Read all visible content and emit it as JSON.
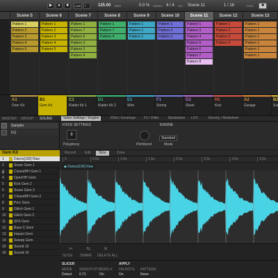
{
  "transport": {
    "tempo": "125.00",
    "tempo_unit": "BPM",
    "swing": "0.0 %",
    "swing_label": "SWING",
    "bpm_label": "BPM",
    "signature": "4 / 4",
    "sig_label": "SIG",
    "scene": "Scene 11",
    "grid": "1 / 16",
    "sync_label": "SYNC",
    "link_label": "LINK"
  },
  "scenes": [
    "Scene 5",
    "Scene 6",
    "Scene 7",
    "Scene 8",
    "Scene 9",
    "Scene 10",
    "Scene 11",
    "Scene 12",
    "Scene 13"
  ],
  "selected_scene": 6,
  "columns": [
    {
      "color": "#b89a2c",
      "cells": [
        "Pattern 1",
        "Pattern 2",
        "Pattern 3",
        "Pattern 4",
        "Pattern 5"
      ]
    },
    {
      "color": "#c8b400",
      "cells": [
        "Pattern 1",
        "Pattern 2",
        "Pattern 3",
        "Pattern 4",
        "Pattern 5"
      ]
    },
    {
      "color": "#8fb040",
      "cells": [
        "Pattern 1",
        "Pattern 7",
        "Pattern 5",
        "Pattern 3",
        "Pattern 2",
        "Pattern 4"
      ]
    },
    {
      "color": "#3faf6b",
      "cells": [
        "Pattern 1",
        "Pattern 7",
        "Pattern 4"
      ]
    },
    {
      "color": "#3fa7c6",
      "cells": [
        "Pattern 1",
        "Pattern 1",
        "Pattern 1"
      ]
    },
    {
      "color": "#6f6fd8",
      "cells": [
        "Pattern 1",
        "Pattern 2",
        "Pattern 3"
      ]
    },
    {
      "color": "#b15ec6",
      "cells": [
        "Pattern 1",
        "Pattern 3",
        "Pattern 4",
        "Pattern 5",
        "Pattern 6",
        "Pattern 7",
        "Pattern 8"
      ]
    },
    {
      "color": "#c84a3a",
      "cells": [
        "Pattern 1",
        "Pattern 2",
        "Pattern 3",
        "Pattern 4"
      ]
    },
    {
      "color": "#c8843a",
      "cells": [
        "Pattern 1",
        "Pattern 1",
        "Pattern 1",
        "Pattern 1",
        "Pattern 1",
        "Pattern 1"
      ]
    }
  ],
  "groups": [
    {
      "letter": "A1",
      "name": "Doer Kit",
      "color": "#c9a34a"
    },
    {
      "letter": "B1",
      "name": "Gem Kit",
      "color": "#c8b400"
    },
    {
      "letter": "C1",
      "name": "Klatter Kit 1",
      "color": "#9cc04a"
    },
    {
      "letter": "D1",
      "name": "Klatter Kit 2",
      "color": "#3fbf7a"
    },
    {
      "letter": "E1",
      "name": "Wim",
      "color": "#3fb2d6"
    },
    {
      "letter": "F1",
      "name": "Stomp",
      "color": "#8080e0"
    },
    {
      "letter": "G1",
      "name": "Skeel",
      "color": "#c070d8"
    },
    {
      "letter": "H1",
      "name": "Kick",
      "color": "#e05a4a"
    },
    {
      "letter": "A2",
      "name": "Garage",
      "color": "#e0903a"
    },
    {
      "letter": "B2",
      "name": "Sub",
      "color": "#e0c040"
    }
  ],
  "selected_group": 1,
  "tabs_left": [
    "MASTER",
    "GROUP",
    "SOUND"
  ],
  "tabs_params": [
    "Voice Settings / Engine",
    "Pitch / Envelope",
    "FX / Filter",
    "Modulation",
    "LFO",
    "Velocity / Modwheel"
  ],
  "voice": {
    "section1": "VOICE SETTINGS",
    "section2": "ENGINE",
    "polyphony_value": "8",
    "polyphony_label": "Polyphony",
    "pitchbend_label": "Pitchbend",
    "mode_value": "Standard",
    "mode_label": "Mode"
  },
  "sound_header": "Gem Kit",
  "plugin_slots": [
    {
      "name": "Sampler"
    },
    {
      "name": "EQ"
    }
  ],
  "sounds": [
    {
      "num": "1",
      "name": "Dairos[100] Raw",
      "color": "#c8b400"
    },
    {
      "num": "2",
      "name": "Snare Gem 1",
      "color": "#c8b400"
    },
    {
      "num": "3",
      "name": "ClosedHH Gem 1",
      "color": "#c8b400"
    },
    {
      "num": "4",
      "name": "OpenHH Gem",
      "color": "#c8b400"
    },
    {
      "num": "5",
      "name": "Kick Gem 2",
      "color": "#c8b400"
    },
    {
      "num": "6",
      "name": "Snare Gem 3",
      "color": "#c8b400"
    },
    {
      "num": "7",
      "name": "ClosedHH Gem 2",
      "color": "#c8b400"
    },
    {
      "num": "8",
      "name": "Perc Gem",
      "color": "#c8b400"
    },
    {
      "num": "9",
      "name": "Glitch Gem 1",
      "color": "#c8b400"
    },
    {
      "num": "10",
      "name": "Glitch Gem 2",
      "color": "#c8b400"
    },
    {
      "num": "11",
      "name": "SFX Gem",
      "color": "#c8b400"
    },
    {
      "num": "12",
      "name": "Bass C Gem",
      "color": "#c8b400"
    },
    {
      "num": "13",
      "name": "Impact Gem",
      "color": "#c8b400"
    },
    {
      "num": "14",
      "name": "Sweep Gem",
      "color": "#c8b400"
    },
    {
      "num": "15",
      "name": "Sound 15",
      "color": "#c8b400"
    },
    {
      "num": "16",
      "name": "Sound 16",
      "color": "#c8b400"
    }
  ],
  "editor_tabs": [
    "Record",
    "Edit",
    "Slice",
    "Zone"
  ],
  "selected_editor_tab": 2,
  "sample_name": "Dairos[100] Raw",
  "timeline_ticks": [
    "0",
    "0.5s",
    "1.0s",
    "1.5s",
    "2.0s",
    "2.5s",
    "3.0s",
    "3.5s"
  ],
  "bottom_icons": [
    "SLICE",
    "SHARE",
    "DELETE ALL"
  ],
  "slicer": {
    "title": "SLICER",
    "apply_title": "APPLY",
    "labels": [
      "MODE",
      "SENSITIVITY",
      "ZERO-X",
      "ON NOTE",
      "PATTERN"
    ],
    "values": [
      "Detect",
      "0.71",
      "On",
      "On",
      "None"
    ]
  },
  "wave_color": "#49d4e6"
}
